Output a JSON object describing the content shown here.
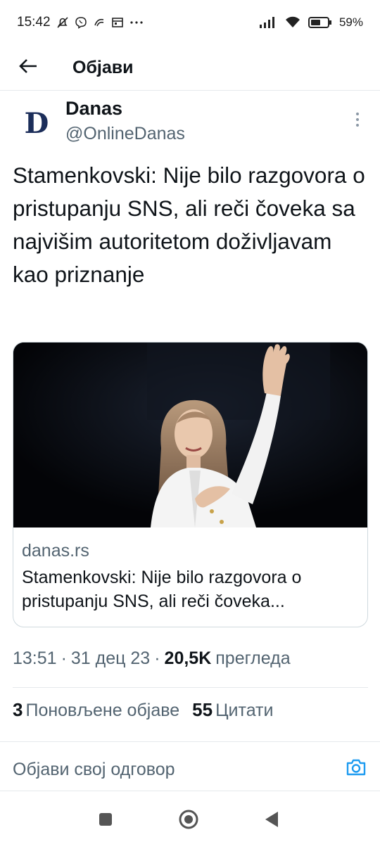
{
  "status_bar": {
    "time": "15:42",
    "icons": [
      "muted-bell-icon",
      "viber-icon",
      "app-icon",
      "calendar-icon",
      "more-dots-icon",
      "signal-icon",
      "wifi-icon",
      "battery-icon"
    ],
    "battery_percent": "59%",
    "battery_level": 0.59
  },
  "header": {
    "back_icon": "arrow-left-icon",
    "title": "Објави"
  },
  "tweet": {
    "author": {
      "avatar_letter": "D",
      "name": "Danas",
      "handle": "@OnlineDanas"
    },
    "text": "Stamenkovski: Nije bilo razgovora o pristupanju SNS, ali reči čoveka sa najvišim autoritetom doživljavam kao priznanje",
    "card": {
      "domain": "danas.rs",
      "title": "Stamenkovski: Nije bilo razgovora o pristupanju SNS, ali reči čoveka..."
    },
    "time": "13:51",
    "date": "31 дец 23",
    "views_count": "20,5K",
    "views_label": "прегледа",
    "reposts_count": "3",
    "reposts_label": "Поновљене објаве",
    "quotes_count": "55",
    "quotes_label": "Цитати"
  },
  "reply": {
    "placeholder": "Објави свој одговор"
  },
  "colors": {
    "text_primary": "#0f1419",
    "text_secondary": "#536471",
    "accent": "#1d9bf0",
    "divider": "#e6e9ec"
  },
  "nav_bar": {
    "buttons": [
      "recents-square-icon",
      "home-circle-icon",
      "back-triangle-icon"
    ]
  }
}
